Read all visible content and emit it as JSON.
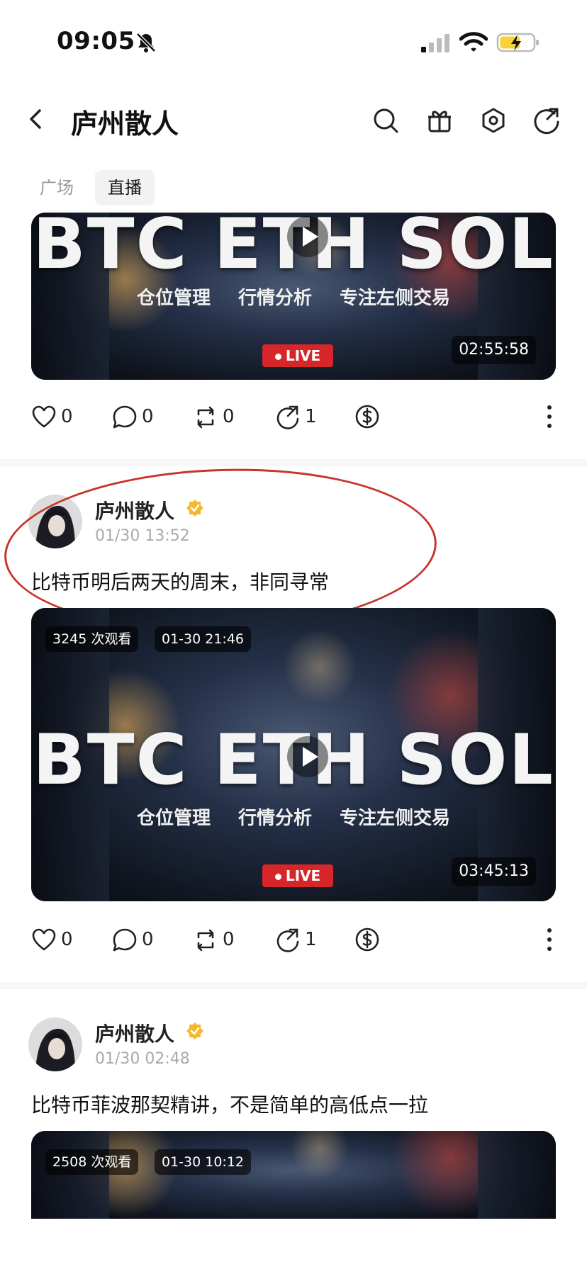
{
  "status_bar": {
    "time": "09:05"
  },
  "header": {
    "title": "庐州散人"
  },
  "tabs": [
    {
      "label": "广场"
    },
    {
      "label": "直播"
    }
  ],
  "video_overlay": {
    "headline": "BTC ETH SOL",
    "subtitles": "仓位管理 行情分析 专注左侧交易",
    "live_label": "LIVE"
  },
  "posts": [
    {
      "video": {
        "duration": "02:55:58"
      },
      "actions": {
        "likes": "0",
        "comments": "0",
        "reposts": "0",
        "shares": "1"
      }
    },
    {
      "author": "庐州散人",
      "time": "01/30 13:52",
      "text": "比特币明后两天的周末，非同寻常",
      "video": {
        "views": "3245 次观看",
        "date": "01-30 21:46",
        "duration": "03:45:13"
      },
      "actions": {
        "likes": "0",
        "comments": "0",
        "reposts": "0",
        "shares": "1"
      }
    },
    {
      "author": "庐州散人",
      "time": "01/30 02:48",
      "text": "比特币菲波那契精讲，不是简单的高低点一拉",
      "video": {
        "views": "2508 次观看",
        "date": "01-30 10:12"
      }
    }
  ],
  "colors": {
    "verified": "#F3B92B",
    "live_red": "#D6262A",
    "annotation_red": "#C8342C"
  }
}
